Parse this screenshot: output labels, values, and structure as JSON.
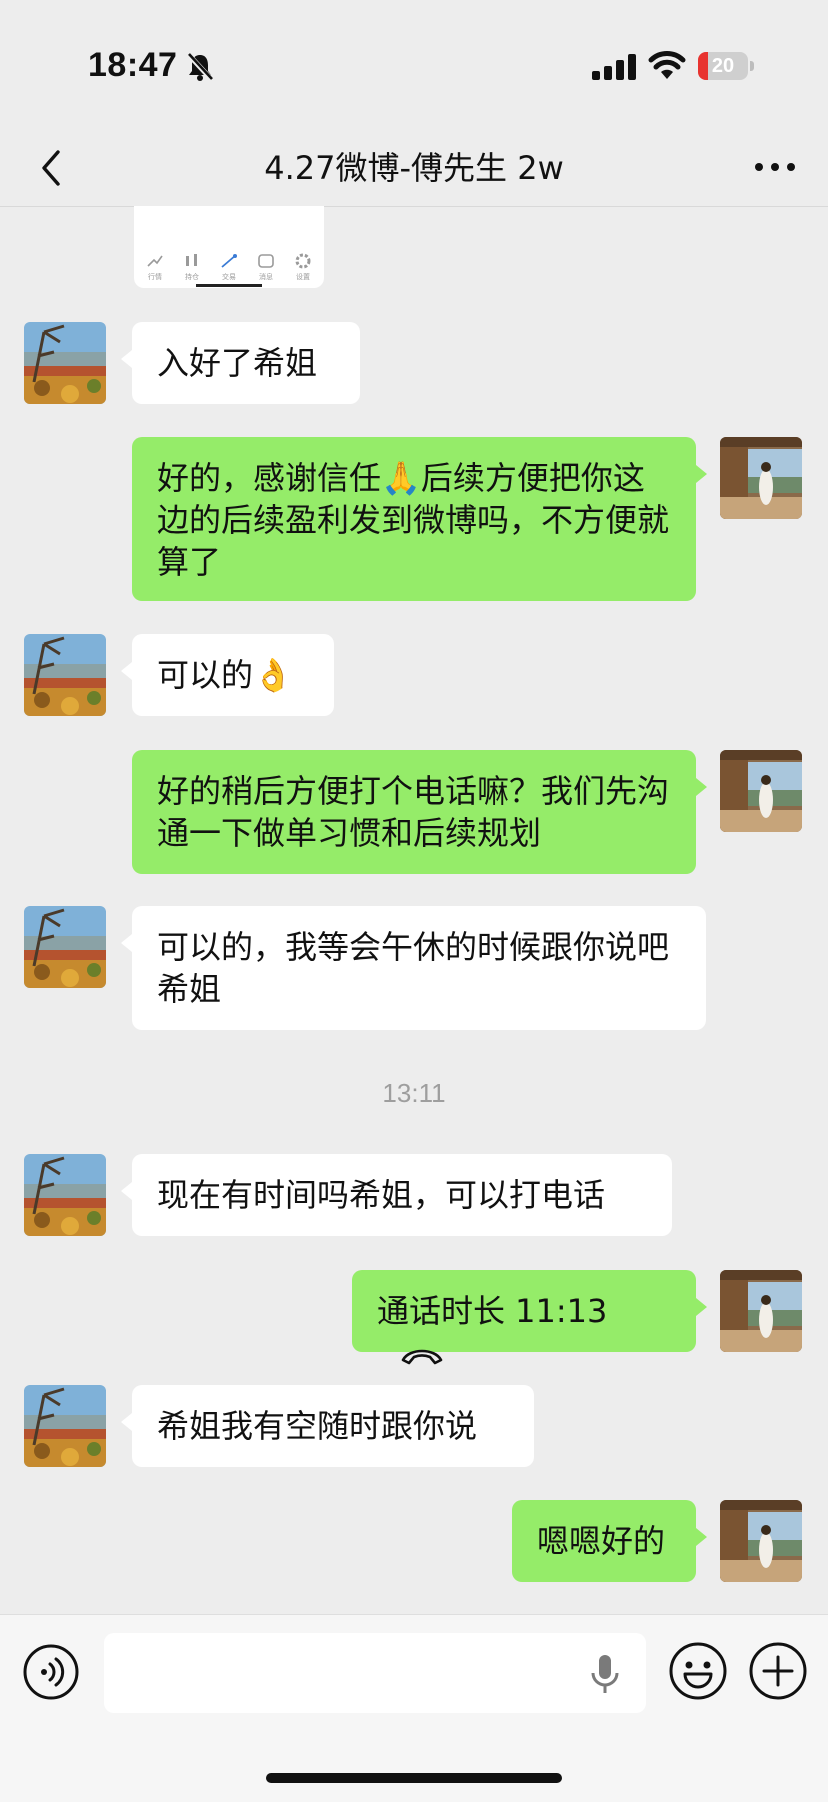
{
  "status": {
    "time": "18:47",
    "battery": "20",
    "battery_level": 0.2
  },
  "header": {
    "title": "4.27微博-傅先生 2w"
  },
  "shared_card": {
    "tabs": [
      "行情",
      "持仓",
      "交易",
      "消息",
      "设置"
    ]
  },
  "messages": [
    {
      "side": "left",
      "text": "入好了希姐"
    },
    {
      "side": "right",
      "text": "好的，感谢信任🙏后续方便把你这边的后续盈利发到微博吗，不方便就算了"
    },
    {
      "side": "left",
      "text": "可以的👌"
    },
    {
      "side": "right",
      "text": "好的稍后方便打个电话嘛？我们先沟通一下做单习惯和后续规划"
    },
    {
      "side": "left",
      "text": "可以的，我等会午休的时候跟你说吧希姐"
    },
    {
      "side": "left",
      "text": "现在有时间吗希姐，可以打电话"
    },
    {
      "side": "right",
      "text": "通话时长 11:13",
      "type": "call"
    },
    {
      "side": "left",
      "text": "希姐我有空随时跟你说"
    },
    {
      "side": "right",
      "text": "嗯嗯好的"
    }
  ],
  "timestamp": "13:11",
  "colors": {
    "background": "#ededed",
    "bubble_self": "#95ec69",
    "bubble_other": "#ffffff"
  },
  "icons": {
    "back": "chevron-left-icon",
    "more": "more-icon",
    "voice": "voice-icon",
    "mic": "mic-icon",
    "emoji": "emoji-icon",
    "plus": "plus-icon",
    "call": "phone-hangup-icon"
  }
}
